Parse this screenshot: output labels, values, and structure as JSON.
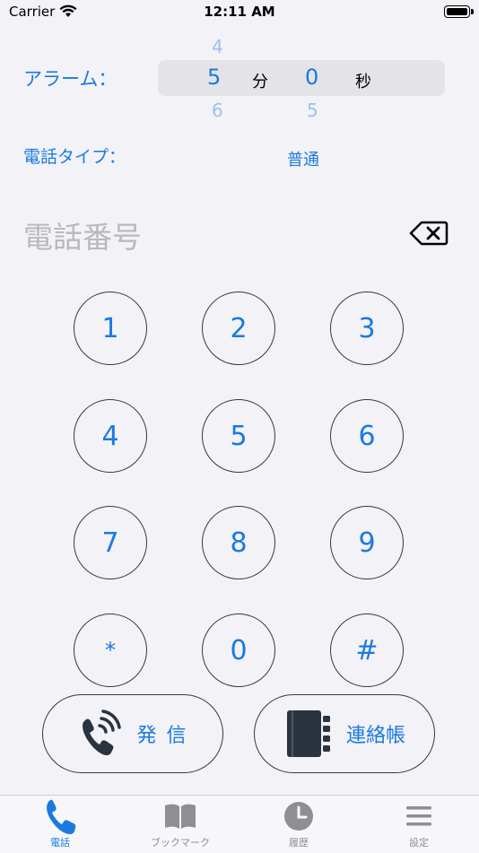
{
  "status": {
    "carrier": "Carrier",
    "time": "12:11 AM"
  },
  "alarm": {
    "label": "アラーム：",
    "minutes": {
      "above": "4",
      "value": "5",
      "below": "6",
      "unit": "分"
    },
    "seconds": {
      "value": "0",
      "below": "5",
      "unit": "秒"
    }
  },
  "phone_type": {
    "label": "電話タイプ：",
    "value": "普通"
  },
  "phone_number": {
    "placeholder": "電話番号"
  },
  "keypad": [
    "1",
    "2",
    "3",
    "4",
    "5",
    "6",
    "7",
    "8",
    "9",
    "*",
    "0",
    "#"
  ],
  "actions": {
    "call_label": "発 信",
    "contacts_label": "連絡帳"
  },
  "tabs": [
    {
      "label": "電話",
      "icon": "phone-icon"
    },
    {
      "label": "ブックマーク",
      "icon": "book-icon"
    },
    {
      "label": "履歴",
      "icon": "clock-icon"
    },
    {
      "label": "設定",
      "icon": "menu-icon"
    }
  ],
  "colors": {
    "accent": "#1a7ae0",
    "inactive": "#8e8e93",
    "background": "#f2f2f7"
  }
}
